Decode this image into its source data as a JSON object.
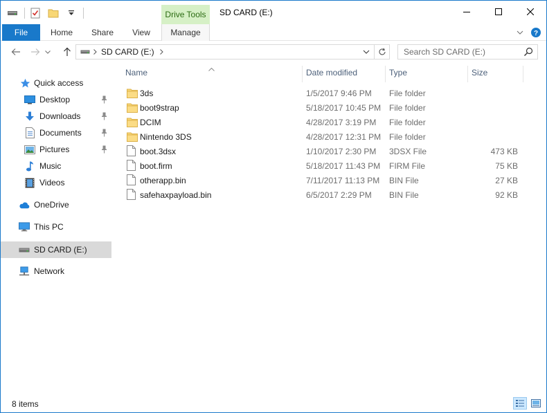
{
  "window": {
    "title": "SD CARD (E:)",
    "context_tab": "Drive Tools"
  },
  "ribbon": {
    "tabs": [
      "File",
      "Home",
      "Share",
      "View",
      "Manage"
    ]
  },
  "address": {
    "crumb": "SD CARD (E:)",
    "search_placeholder": "Search SD CARD (E:)"
  },
  "nav": {
    "quick_access": "Quick access",
    "pinned": [
      {
        "label": "Desktop",
        "icon": "desktop-icon"
      },
      {
        "label": "Downloads",
        "icon": "downloads-icon"
      },
      {
        "label": "Documents",
        "icon": "documents-icon"
      },
      {
        "label": "Pictures",
        "icon": "pictures-icon"
      }
    ],
    "other": [
      {
        "label": "Music",
        "icon": "music-icon"
      },
      {
        "label": "Videos",
        "icon": "videos-icon"
      }
    ],
    "onedrive": "OneDrive",
    "thispc": "This PC",
    "sdcard": "SD CARD (E:)",
    "network": "Network"
  },
  "columns": {
    "name": "Name",
    "date": "Date modified",
    "type": "Type",
    "size": "Size"
  },
  "files": [
    {
      "name": "3ds",
      "date": "1/5/2017 9:46 PM",
      "type": "File folder",
      "size": "",
      "kind": "folder"
    },
    {
      "name": "boot9strap",
      "date": "5/18/2017 10:45 PM",
      "type": "File folder",
      "size": "",
      "kind": "folder"
    },
    {
      "name": "DCIM",
      "date": "4/28/2017 3:19 PM",
      "type": "File folder",
      "size": "",
      "kind": "folder"
    },
    {
      "name": "Nintendo 3DS",
      "date": "4/28/2017 12:31 PM",
      "type": "File folder",
      "size": "",
      "kind": "folder"
    },
    {
      "name": "boot.3dsx",
      "date": "1/10/2017 2:30 PM",
      "type": "3DSX File",
      "size": "473 KB",
      "kind": "file"
    },
    {
      "name": "boot.firm",
      "date": "5/18/2017 11:43 PM",
      "type": "FIRM File",
      "size": "75 KB",
      "kind": "file"
    },
    {
      "name": "otherapp.bin",
      "date": "7/11/2017 11:13 PM",
      "type": "BIN File",
      "size": "27 KB",
      "kind": "file"
    },
    {
      "name": "safehaxpayload.bin",
      "date": "6/5/2017 2:29 PM",
      "type": "BIN File",
      "size": "92 KB",
      "kind": "file"
    }
  ],
  "status": {
    "count": "8 items"
  },
  "colors": {
    "accent": "#1979ca",
    "folder": "#f8d775",
    "context_tab_bg": "#d6f0c6",
    "selected_nav": "#d9d9d9"
  }
}
